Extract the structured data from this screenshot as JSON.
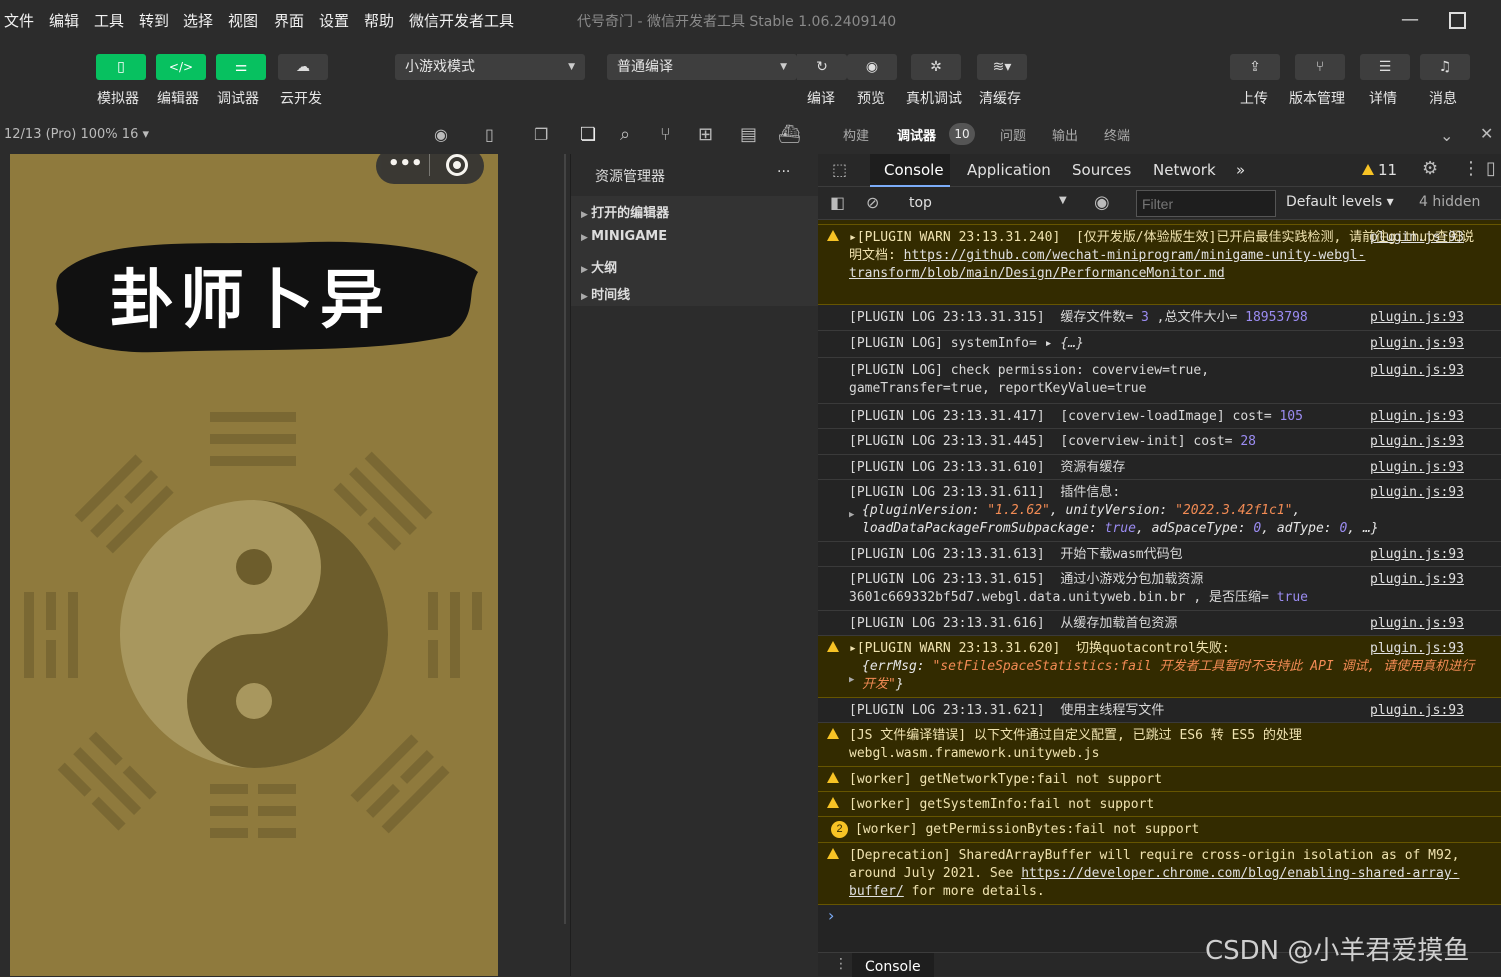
{
  "menubar": {
    "items": [
      "文件",
      "编辑",
      "工具",
      "转到",
      "选择",
      "视图",
      "界面",
      "设置",
      "帮助",
      "微信开发者工具"
    ],
    "title": "代号奇门 - 微信开发者工具 Stable 1.06.2409140"
  },
  "toolbar": {
    "left": [
      {
        "label": "模拟器",
        "icon": "phone-icon"
      },
      {
        "label": "编辑器",
        "icon": "code-icon"
      },
      {
        "label": "调试器",
        "icon": "debug-sliders-icon"
      },
      {
        "label": "云开发",
        "icon": "cloud-icon"
      }
    ],
    "mode": "小游戏模式",
    "compile": "普通编译",
    "mid": [
      "编译",
      "预览",
      "真机调试",
      "清缓存"
    ],
    "right": [
      "上传",
      "版本管理",
      "详情",
      "消息"
    ]
  },
  "subbar": {
    "device": "12/13 (Pro) 100% 16 ▾"
  },
  "simulator": {
    "banner_text": "卦师卜异",
    "bg": "#8f7a3d"
  },
  "explorer": {
    "header": "资源管理器",
    "more": "···",
    "items": [
      "打开的编辑器",
      "MINIGAME",
      "大纲",
      "时间线"
    ]
  },
  "devtop": {
    "tabs": [
      "构建",
      "调试器",
      "问题",
      "输出",
      "终端"
    ],
    "badge": "10"
  },
  "devtools": {
    "tabs": [
      "Console",
      "Application",
      "Sources",
      "Network"
    ],
    "warn_count": "11"
  },
  "ctrl": {
    "context": "top",
    "filter_placeholder": "Filter",
    "levels": "Default levels ▾",
    "hidden": "4 hidden"
  },
  "console": {
    "src": "plugin.js:93",
    "rows": [
      {
        "warn": true,
        "a": "▸[PLUGIN WARN 23:13.31.240]  [仅开发版/体验版生效]已开启最佳实践检测, 请前往github查阅说明文档:",
        "link": "https://github.com/wechat-miniprogram/minigame-unity-webgl-transform/blob/main/Design/PerformanceMonitor.md"
      },
      {
        "a": "[PLUGIN LOG 23:13.31.315]  缓存文件数= ",
        "n1": "3",
        "b": " ,总文件大小= ",
        "n2": "18953798"
      },
      {
        "a": "[PLUGIN LOG] systemInfo= ",
        "b": "▸ {…}"
      },
      {
        "a": "[PLUGIN LOG] check permission: coverview=true, gameTransfer=true, reportKeyValue=true"
      },
      {
        "a": "[PLUGIN LOG 23:13.31.417]  [coverview-loadImage] cost= ",
        "n1": "105"
      },
      {
        "a": "[PLUGIN LOG 23:13.31.445]  [coverview-init] cost= ",
        "n1": "28"
      },
      {
        "a": "[PLUGIN LOG 23:13.31.610]  资源有缓存"
      },
      {
        "a": "[PLUGIN LOG 23:13.31.611]  插件信息:",
        "obj1": "{pluginVersion: ",
        "s1": "\"1.2.62\"",
        "obj2": ", unityVersion: ",
        "s2": "\"2022.3.42f1c1\"",
        "obj3": ", loadDataPackageFromSubpackage: ",
        "k1": "true",
        "obj4": ", adSpaceType: ",
        "k2": "0",
        "obj5": ", adType: ",
        "k3": "0",
        "obj6": ", …}"
      },
      {
        "a": "[PLUGIN LOG 23:13.31.613]  开始下载wasm代码包"
      },
      {
        "a": "[PLUGIN LOG 23:13.31.615]  通过小游戏分包加载资源",
        "l2": "3601c669332bf5d7.webgl.data.unityweb.bin.br , 是否压缩= ",
        "k1": "true"
      },
      {
        "a": "[PLUGIN LOG 23:13.31.616]  从缓存加载首包资源"
      },
      {
        "warn": true,
        "a": "▸[PLUGIN WARN 23:13.31.620]  切换quotacontrol失败:",
        "obj": "{errMsg: ",
        "s1": "\"setFileSpaceStatistics:fail 开发者工具暂时不支持此 API 调试, 请使用真机进行开发\"",
        "end": "}"
      },
      {
        "a": "[PLUGIN LOG 23:13.31.621]  使用主线程写文件"
      },
      {
        "warn": true,
        "a": "[JS 文件编译错误] 以下文件通过自定义配置, 已跳过 ES6 转 ES5 的处理",
        "l2": "webgl.wasm.framework.unityweb.js"
      },
      {
        "warn": true,
        "a": "[worker] getNetworkType:fail not support"
      },
      {
        "warn": true,
        "a": "[worker] getSystemInfo:fail not support"
      },
      {
        "warn": true,
        "count": "2",
        "a": "[worker] getPermissionBytes:fail not support"
      },
      {
        "warn": true,
        "a": "[Deprecation] SharedArrayBuffer will require cross-origin isolation as of M92, around July 2021. See ",
        "link": "https://developer.chrome.com/blog/enabling-shared-array-buffer/",
        "b": " for more details."
      }
    ],
    "prompt": "›"
  },
  "bottom": {
    "tab": "Console",
    "menu": "⋮"
  },
  "watermark": "CSDN @小羊君爱摸鱼",
  "colors": {
    "green": "#07c160",
    "warn_bg": "#332b00",
    "bg": "#242424"
  }
}
